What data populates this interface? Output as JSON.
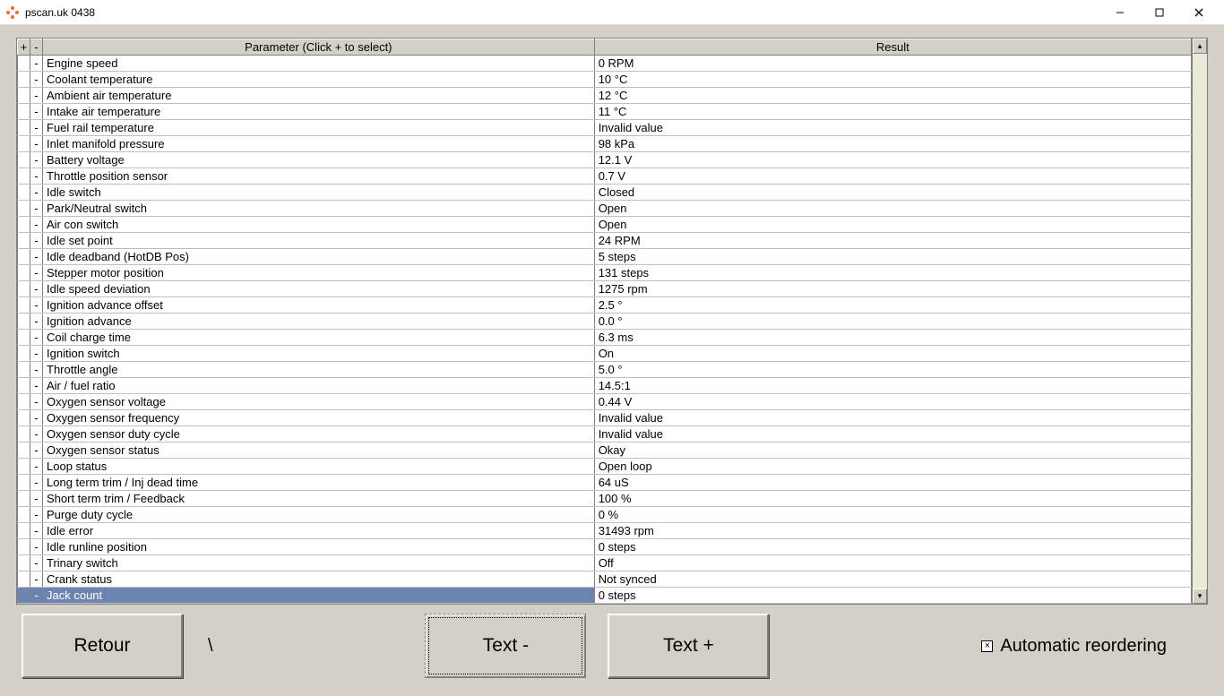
{
  "window": {
    "title": "pscan.uk 0438"
  },
  "table": {
    "header_plus": "+",
    "header_minus": "-",
    "header_param": "Parameter (Click + to select)",
    "header_result": "Result",
    "rows": [
      {
        "flag": "-",
        "param": "Engine speed",
        "result": "0 RPM",
        "selected": false
      },
      {
        "flag": "-",
        "param": "Coolant temperature",
        "result": "10 °C",
        "selected": false
      },
      {
        "flag": "-",
        "param": "Ambient air temperature",
        "result": "12 °C",
        "selected": false
      },
      {
        "flag": "-",
        "param": "Intake air temperature",
        "result": "11 °C",
        "selected": false
      },
      {
        "flag": "-",
        "param": "Fuel rail temperature",
        "result": "Invalid value",
        "selected": false
      },
      {
        "flag": "-",
        "param": "Inlet manifold pressure",
        "result": "98 kPa",
        "selected": false
      },
      {
        "flag": "-",
        "param": "Battery voltage",
        "result": "12.1 V",
        "selected": false
      },
      {
        "flag": "-",
        "param": "Throttle position sensor",
        "result": "0.7 V",
        "selected": false
      },
      {
        "flag": "-",
        "param": "Idle switch",
        "result": "Closed",
        "selected": false
      },
      {
        "flag": "-",
        "param": "Park/Neutral switch",
        "result": "Open",
        "selected": false
      },
      {
        "flag": "-",
        "param": "Air con switch",
        "result": "Open",
        "selected": false
      },
      {
        "flag": "-",
        "param": "Idle set point",
        "result": "24 RPM",
        "selected": false
      },
      {
        "flag": "-",
        "param": "Idle deadband (HotDB Pos)",
        "result": "5 steps",
        "selected": false
      },
      {
        "flag": "-",
        "param": "Stepper motor position",
        "result": "131 steps",
        "selected": false
      },
      {
        "flag": "-",
        "param": "Idle speed deviation",
        "result": "1275 rpm",
        "selected": false
      },
      {
        "flag": "-",
        "param": "Ignition advance offset",
        "result": "2.5 °",
        "selected": false
      },
      {
        "flag": "-",
        "param": "Ignition advance",
        "result": "0.0 °",
        "selected": false
      },
      {
        "flag": "-",
        "param": "Coil charge time",
        "result": "6.3 ms",
        "selected": false
      },
      {
        "flag": "-",
        "param": "Ignition switch",
        "result": "On",
        "selected": false
      },
      {
        "flag": "-",
        "param": "Throttle angle",
        "result": "5.0 °",
        "selected": false
      },
      {
        "flag": "-",
        "param": "Air / fuel ratio",
        "result": "14.5:1",
        "selected": false
      },
      {
        "flag": "-",
        "param": "Oxygen sensor voltage",
        "result": "0.44 V",
        "selected": false
      },
      {
        "flag": "-",
        "param": "Oxygen sensor frequency",
        "result": "Invalid value",
        "selected": false
      },
      {
        "flag": "-",
        "param": "Oxygen sensor duty cycle",
        "result": "Invalid value",
        "selected": false
      },
      {
        "flag": "-",
        "param": "Oxygen sensor status",
        "result": "Okay",
        "selected": false
      },
      {
        "flag": "-",
        "param": "Loop status",
        "result": "Open loop",
        "selected": false
      },
      {
        "flag": "-",
        "param": "Long term trim / Inj dead time",
        "result": "64 uS",
        "selected": false
      },
      {
        "flag": "-",
        "param": "Short term trim / Feedback",
        "result": "100 %",
        "selected": false
      },
      {
        "flag": "-",
        "param": "Purge duty cycle",
        "result": "0 %",
        "selected": false
      },
      {
        "flag": "-",
        "param": "Idle error",
        "result": "31493 rpm",
        "selected": false
      },
      {
        "flag": "-",
        "param": "Idle runline position",
        "result": "0 steps",
        "selected": false
      },
      {
        "flag": "-",
        "param": "Trinary switch",
        "result": "Off",
        "selected": false
      },
      {
        "flag": "-",
        "param": "Crank status",
        "result": "Not synced",
        "selected": false
      },
      {
        "flag": "-",
        "param": "Jack count",
        "result": "0 steps",
        "selected": true
      }
    ]
  },
  "buttons": {
    "retour": "Retour",
    "slash": "\\",
    "text_minus": "Text -",
    "text_plus": "Text +"
  },
  "checkbox": {
    "label": "Automatic reordering",
    "checked_glyph": "×"
  }
}
